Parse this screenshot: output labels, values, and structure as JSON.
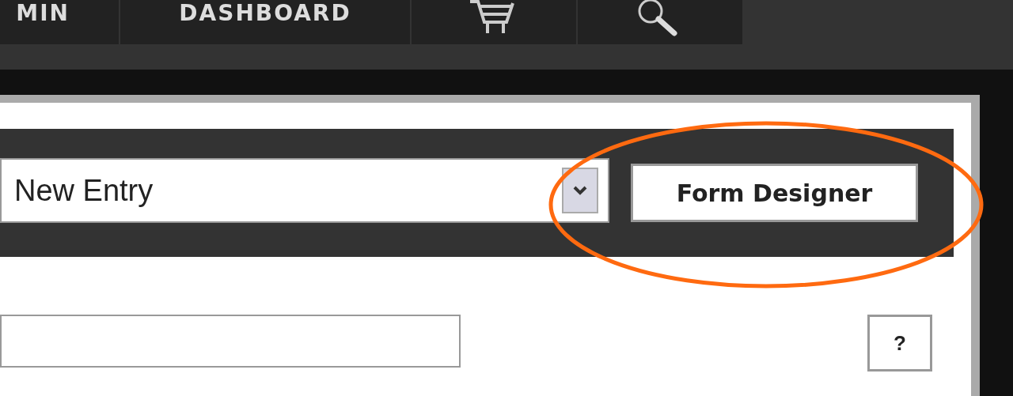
{
  "nav": {
    "items": [
      {
        "kind": "text",
        "label": "MIN"
      },
      {
        "kind": "text",
        "label": "DASHBOARD"
      },
      {
        "kind": "cart"
      },
      {
        "kind": "search"
      }
    ]
  },
  "toolbar": {
    "entry_select": {
      "value": "New Entry"
    },
    "form_designer_button": "Form Designer"
  },
  "form": {
    "help_button": "?"
  }
}
